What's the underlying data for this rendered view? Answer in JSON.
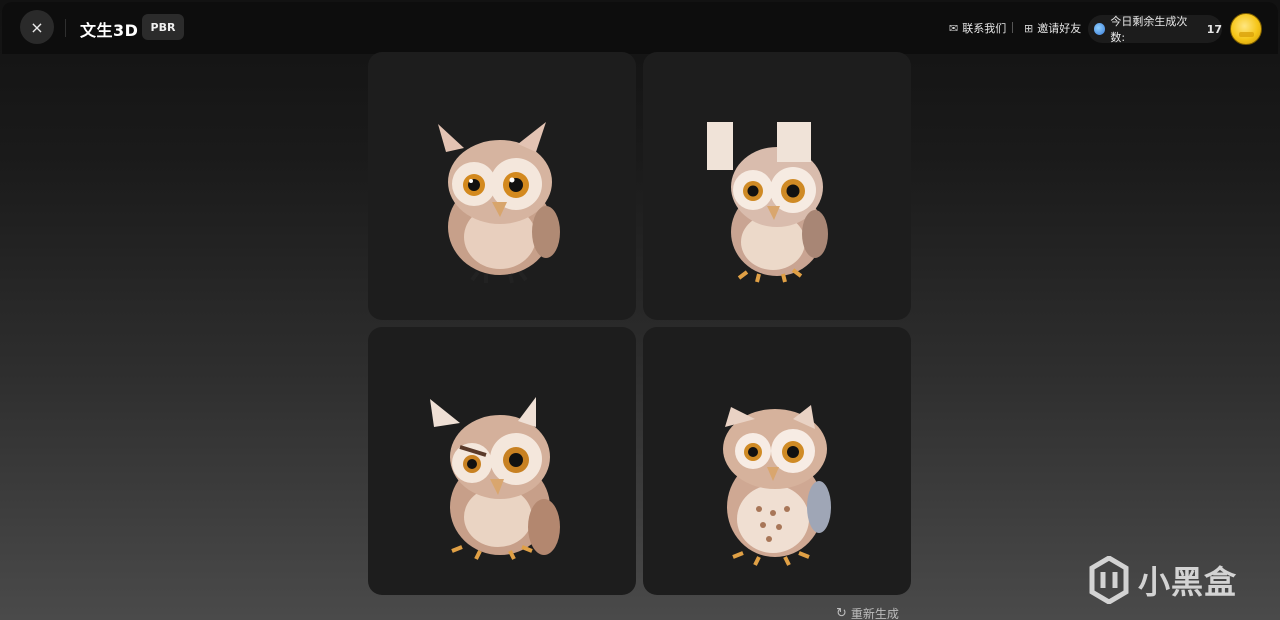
{
  "header": {
    "close_icon": "×",
    "title": "文生3D",
    "badge": "PBR",
    "contact_icon": "✉",
    "contact_label": "联系我们",
    "divider": "|",
    "invite_icon": "⊞",
    "invite_label": "邀请好友",
    "quota_label": "今日剩余生成次数:",
    "quota_value": "17"
  },
  "results": [
    {
      "name": "owl-result-1"
    },
    {
      "name": "owl-result-2"
    },
    {
      "name": "owl-result-3"
    },
    {
      "name": "owl-result-4"
    }
  ],
  "footer": {
    "regenerate_icon": "↻",
    "regenerate_label": "重新生成"
  },
  "watermark": {
    "text": "小黑盒"
  },
  "colors": {
    "accent": "#4a90e2",
    "card_bg": "#1d1d1d",
    "topbar_bg": "#0d0d0d"
  }
}
